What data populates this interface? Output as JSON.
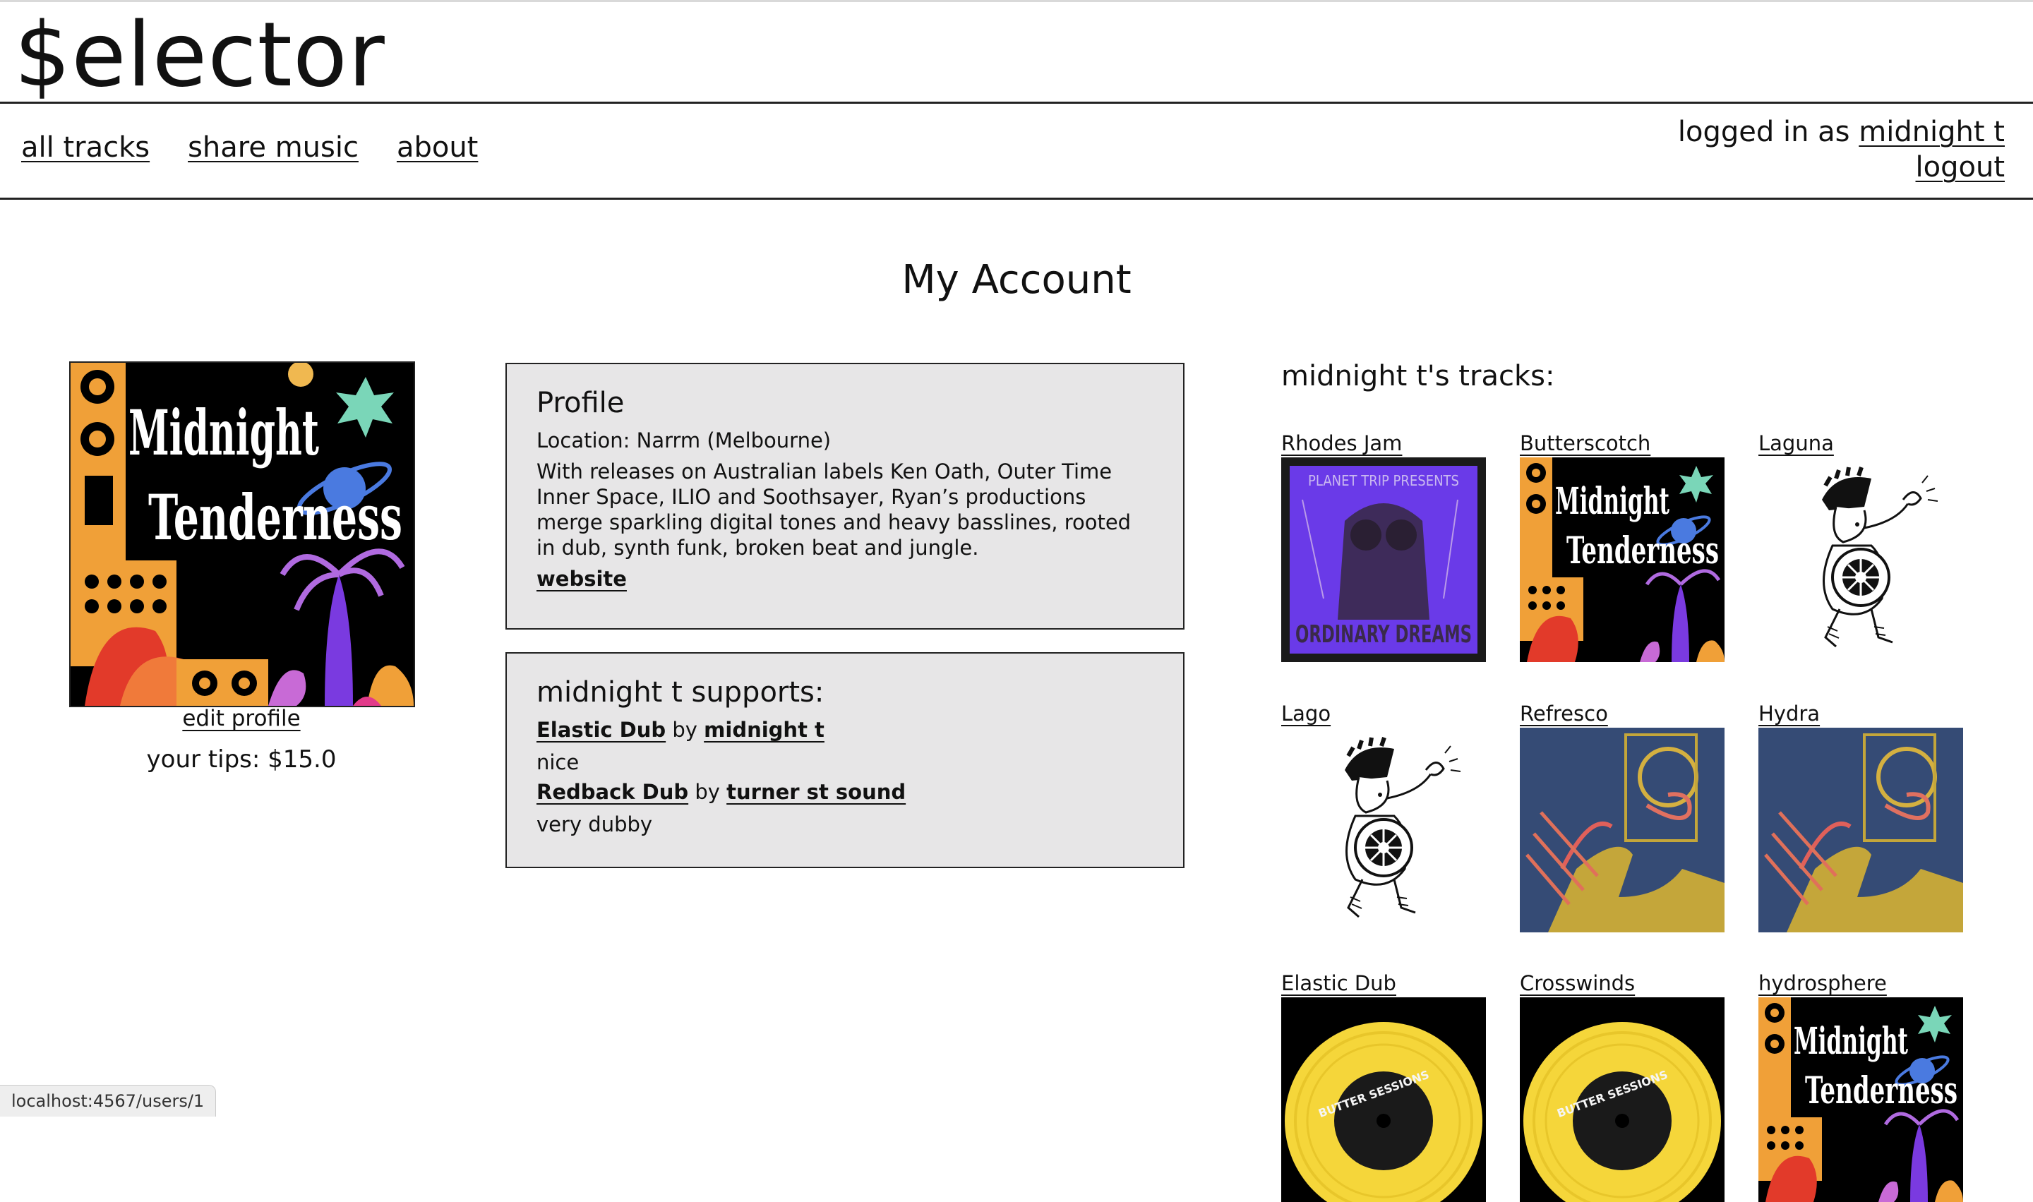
{
  "app": {
    "brand": "$elector"
  },
  "nav": {
    "all_tracks": "all tracks",
    "share_music": "share music",
    "about": "about"
  },
  "user": {
    "logged_in_prefix": "logged in as ",
    "username": "midnight t",
    "logout": "logout"
  },
  "page": {
    "title": "My Account"
  },
  "left": {
    "edit_profile": "edit profile",
    "tips": "your tips: $15.0",
    "avatar_text_1": "Midnight",
    "avatar_text_2": "Tenderness"
  },
  "profile": {
    "heading": "Profile",
    "location": "Location: Narrm (Melbourne)",
    "bio": "With releases on Australian labels Ken Oath, Outer Time Inner Space, ILIO and Soothsayer, Ryan’s productions merge sparkling digital tones and heavy basslines, rooted in dub, synth funk, broken beat and jungle.",
    "website": "website"
  },
  "supports": {
    "heading": "midnight t supports:",
    "by": "by",
    "items": [
      {
        "track": "Elastic Dub",
        "artist": "midnight t",
        "comment": "nice"
      },
      {
        "track": "Redback Dub",
        "artist": "turner st sound",
        "comment": "very dubby"
      }
    ]
  },
  "tracks": {
    "heading": "midnight t's tracks:",
    "items": [
      {
        "title": "Rhodes Jam",
        "art": "planet",
        "art_text_1": "PLANET TRIP PRESENTS",
        "art_text_2": "ORDINARY DREAMS"
      },
      {
        "title": "Butterscotch",
        "art": "midnight",
        "art_text_1": "Midnight",
        "art_text_2": "Tenderness"
      },
      {
        "title": "Laguna",
        "art": "warrior"
      },
      {
        "title": "Lago",
        "art": "warrior"
      },
      {
        "title": "Refresco",
        "art": "blue"
      },
      {
        "title": "Hydra",
        "art": "blue"
      },
      {
        "title": "Elastic Dub",
        "art": "vinyl",
        "art_text_1": "BUTTER SESSIONS"
      },
      {
        "title": "Crosswinds",
        "art": "vinyl",
        "art_text_1": "BUTTER SESSIONS"
      },
      {
        "title": "hydrosphere",
        "art": "midnight",
        "art_text_1": "Midnight",
        "art_text_2": "Tenderness"
      }
    ]
  },
  "status_bar": {
    "url": "localhost:4567/users/1"
  }
}
